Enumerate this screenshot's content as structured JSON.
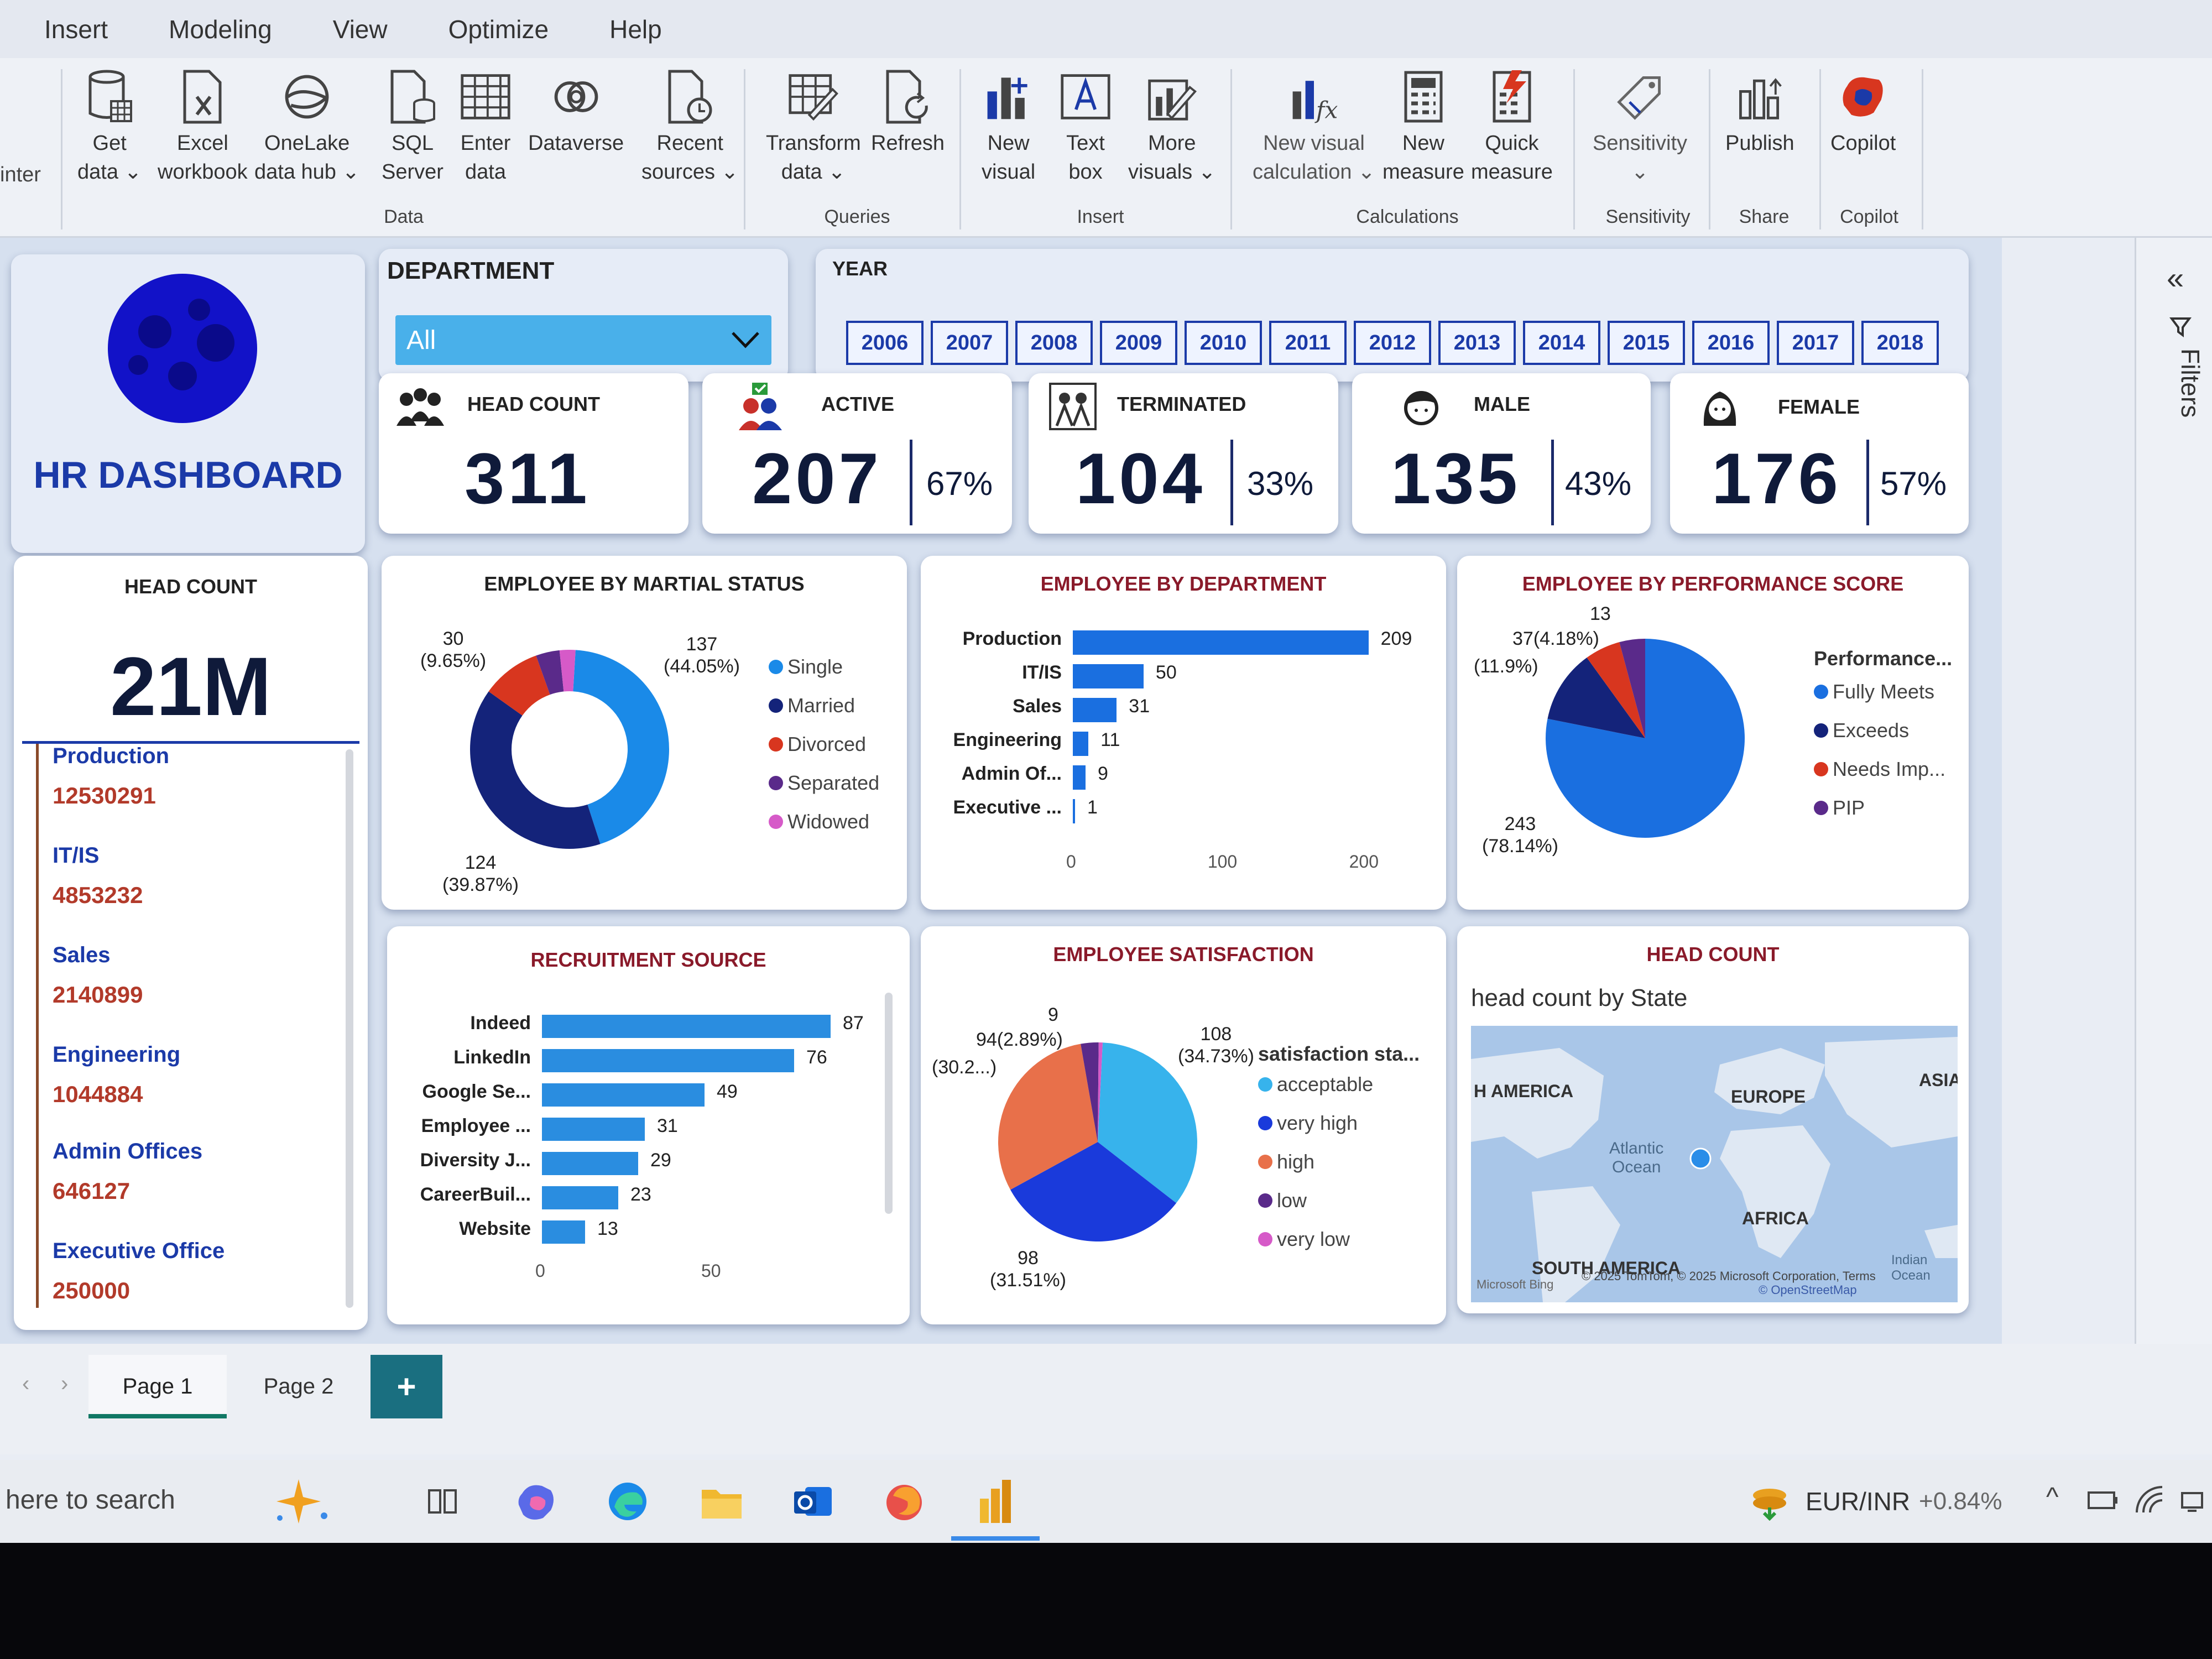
{
  "menu": [
    "Insert",
    "Modeling",
    "View",
    "Optimize",
    "Help"
  ],
  "ribbon": {
    "side_label": "inter",
    "buttons": {
      "get_data": "Get\ndata ⌄",
      "excel": "Excel\nworkbook",
      "onelake": "OneLake\ndata hub ⌄",
      "sql": "SQL\nServer",
      "enter": "Enter\ndata",
      "dataverse": "Dataverse",
      "recent": "Recent\nsources ⌄",
      "transform": "Transform\ndata ⌄",
      "refresh": "Refresh",
      "new_visual": "New\nvisual",
      "text_box": "Text\nbox",
      "more_visuals": "More\nvisuals ⌄",
      "new_visual_calc": "New visual\ncalculation ⌄",
      "new_measure": "New\nmeasure",
      "quick_measure": "Quick\nmeasure",
      "sensitivity": "Sensitivity\n⌄",
      "publish": "Publish",
      "copilot": "Copilot"
    },
    "groups": {
      "data": "Data",
      "queries": "Queries",
      "insert": "Insert",
      "calculations": "Calculations",
      "sensitivity": "Sensitivity",
      "share": "Share",
      "copilot": "Copilot"
    }
  },
  "logo_card": {
    "title": "HR DASHBOARD"
  },
  "department_slicer": {
    "label": "DEPARTMENT",
    "value": "All"
  },
  "year_slicer": {
    "label": "YEAR",
    "years": [
      "2006",
      "2007",
      "2008",
      "2009",
      "2010",
      "2011",
      "2012",
      "2013",
      "2014",
      "2015",
      "2016",
      "2017",
      "2018"
    ]
  },
  "kpis": {
    "headcount": {
      "label": "HEAD COUNT",
      "value": "311"
    },
    "active": {
      "label": "ACTIVE",
      "value": "207",
      "pct": "67%"
    },
    "terminated": {
      "label": "TERMINATED",
      "value": "104",
      "pct": "33%"
    },
    "male": {
      "label": "MALE",
      "value": "135",
      "pct": "43%"
    },
    "female": {
      "label": "FEMALE",
      "value": "176",
      "pct": "57%"
    }
  },
  "headcount_card": {
    "title": "HEAD COUNT",
    "value": "21M",
    "items": [
      {
        "name": "Production",
        "value": "12530291"
      },
      {
        "name": "IT/IS",
        "value": "4853232"
      },
      {
        "name": "Sales",
        "value": "2140899"
      },
      {
        "name": "Engineering",
        "value": "1044884"
      },
      {
        "name": "Admin Offices",
        "value": "646127"
      },
      {
        "name": "Executive Office",
        "value": "250000"
      }
    ]
  },
  "marital": {
    "title": "EMPLOYEE BY MARTIAL STATUS",
    "labels": {
      "single": "137\n(44.05%)",
      "married": "124\n(39.87%)",
      "divorced": "30\n(9.65%)"
    },
    "legend": [
      "Single",
      "Married",
      "Divorced",
      "Separated",
      "Widowed"
    ]
  },
  "department_chart": {
    "title": "EMPLOYEE BY DEPARTMENT"
  },
  "performance": {
    "title": "EMPLOYEE BY PERFORMANCE SCORE",
    "legend_title": "Performance...",
    "legend": [
      "Fully Meets",
      "Exceeds",
      "Needs Imp...",
      "PIP"
    ],
    "labels": {
      "fully": "243\n(78.14%)",
      "exceeds": "(11.9%)",
      "needs": "37(4.18%)",
      "pip": "13"
    }
  },
  "recruitment_chart": {
    "title": "RECRUITMENT SOURCE"
  },
  "satisfaction": {
    "title": "EMPLOYEE SATISFACTION",
    "legend_title": "satisfaction sta...",
    "legend": [
      "acceptable",
      "very high",
      "high",
      "low",
      "very low"
    ],
    "labels": {
      "acceptable": "108\n(34.73%)",
      "very_high": "98\n(31.51%)",
      "high": "94(2.89%)",
      "high_pct": "(30.2...)",
      "low": "9"
    }
  },
  "map_card": {
    "title": "HEAD COUNT",
    "subtitle": "head count by State",
    "regions": {
      "na": "H AMERICA",
      "europe": "EUROPE",
      "asia": "ASIA",
      "atlantic": "Atlantic\nOcean",
      "africa": "AFRICA",
      "sa": "SOUTH AMERICA",
      "ocean": "Indian\nOcean"
    },
    "copyright": "© 2025 TomTom, © 2025 Microsoft Corporation, Terms",
    "osm": "© OpenStreetMap",
    "bing": "Microsoft Bing"
  },
  "pages": {
    "page1": "Page 1",
    "page2": "Page 2",
    "add": "+"
  },
  "filters_label": "Filters",
  "taskbar": {
    "search": "here to search",
    "ticker": "EUR/INR",
    "change": "+0.84%"
  },
  "colors": {
    "accent_blue": "#1a6fe0",
    "dark_blue": "#14237a",
    "orange": "#e8704a",
    "red": "#d8361f",
    "purple": "#5a2a8a",
    "pink": "#d65ac8",
    "light_blue": "#37b3ec"
  },
  "chart_data": [
    {
      "type": "pie",
      "title": "EMPLOYEE BY MARTIAL STATUS",
      "categories": [
        "Single",
        "Married",
        "Divorced",
        "Separated",
        "Widowed"
      ],
      "values": [
        137,
        124,
        30,
        12,
        8
      ]
    },
    {
      "type": "bar",
      "title": "EMPLOYEE BY DEPARTMENT",
      "categories": [
        "Production",
        "IT/IS",
        "Sales",
        "Engineering",
        "Admin Of...",
        "Executive ..."
      ],
      "values": [
        209,
        50,
        31,
        11,
        9,
        1
      ],
      "xticks": [
        "0",
        "100",
        "200"
      ],
      "xlim": [
        0,
        215
      ]
    },
    {
      "type": "pie",
      "title": "EMPLOYEE BY PERFORMANCE SCORE",
      "categories": [
        "Fully Meets",
        "Exceeds",
        "Needs Imp...",
        "PIP"
      ],
      "values": [
        243,
        37,
        18,
        13
      ]
    },
    {
      "type": "bar",
      "title": "RECRUITMENT SOURCE",
      "categories": [
        "Indeed",
        "LinkedIn",
        "Google Se...",
        "Employee ...",
        "Diversity J...",
        "CareerBuil...",
        "Website"
      ],
      "values": [
        87,
        76,
        49,
        31,
        29,
        23,
        13
      ],
      "xticks": [
        "0",
        "50"
      ],
      "xlim": [
        0,
        90
      ]
    },
    {
      "type": "pie",
      "title": "EMPLOYEE SATISFACTION",
      "categories": [
        "acceptable",
        "very high",
        "high",
        "low",
        "very low"
      ],
      "values": [
        108,
        98,
        94,
        9,
        2
      ]
    }
  ]
}
